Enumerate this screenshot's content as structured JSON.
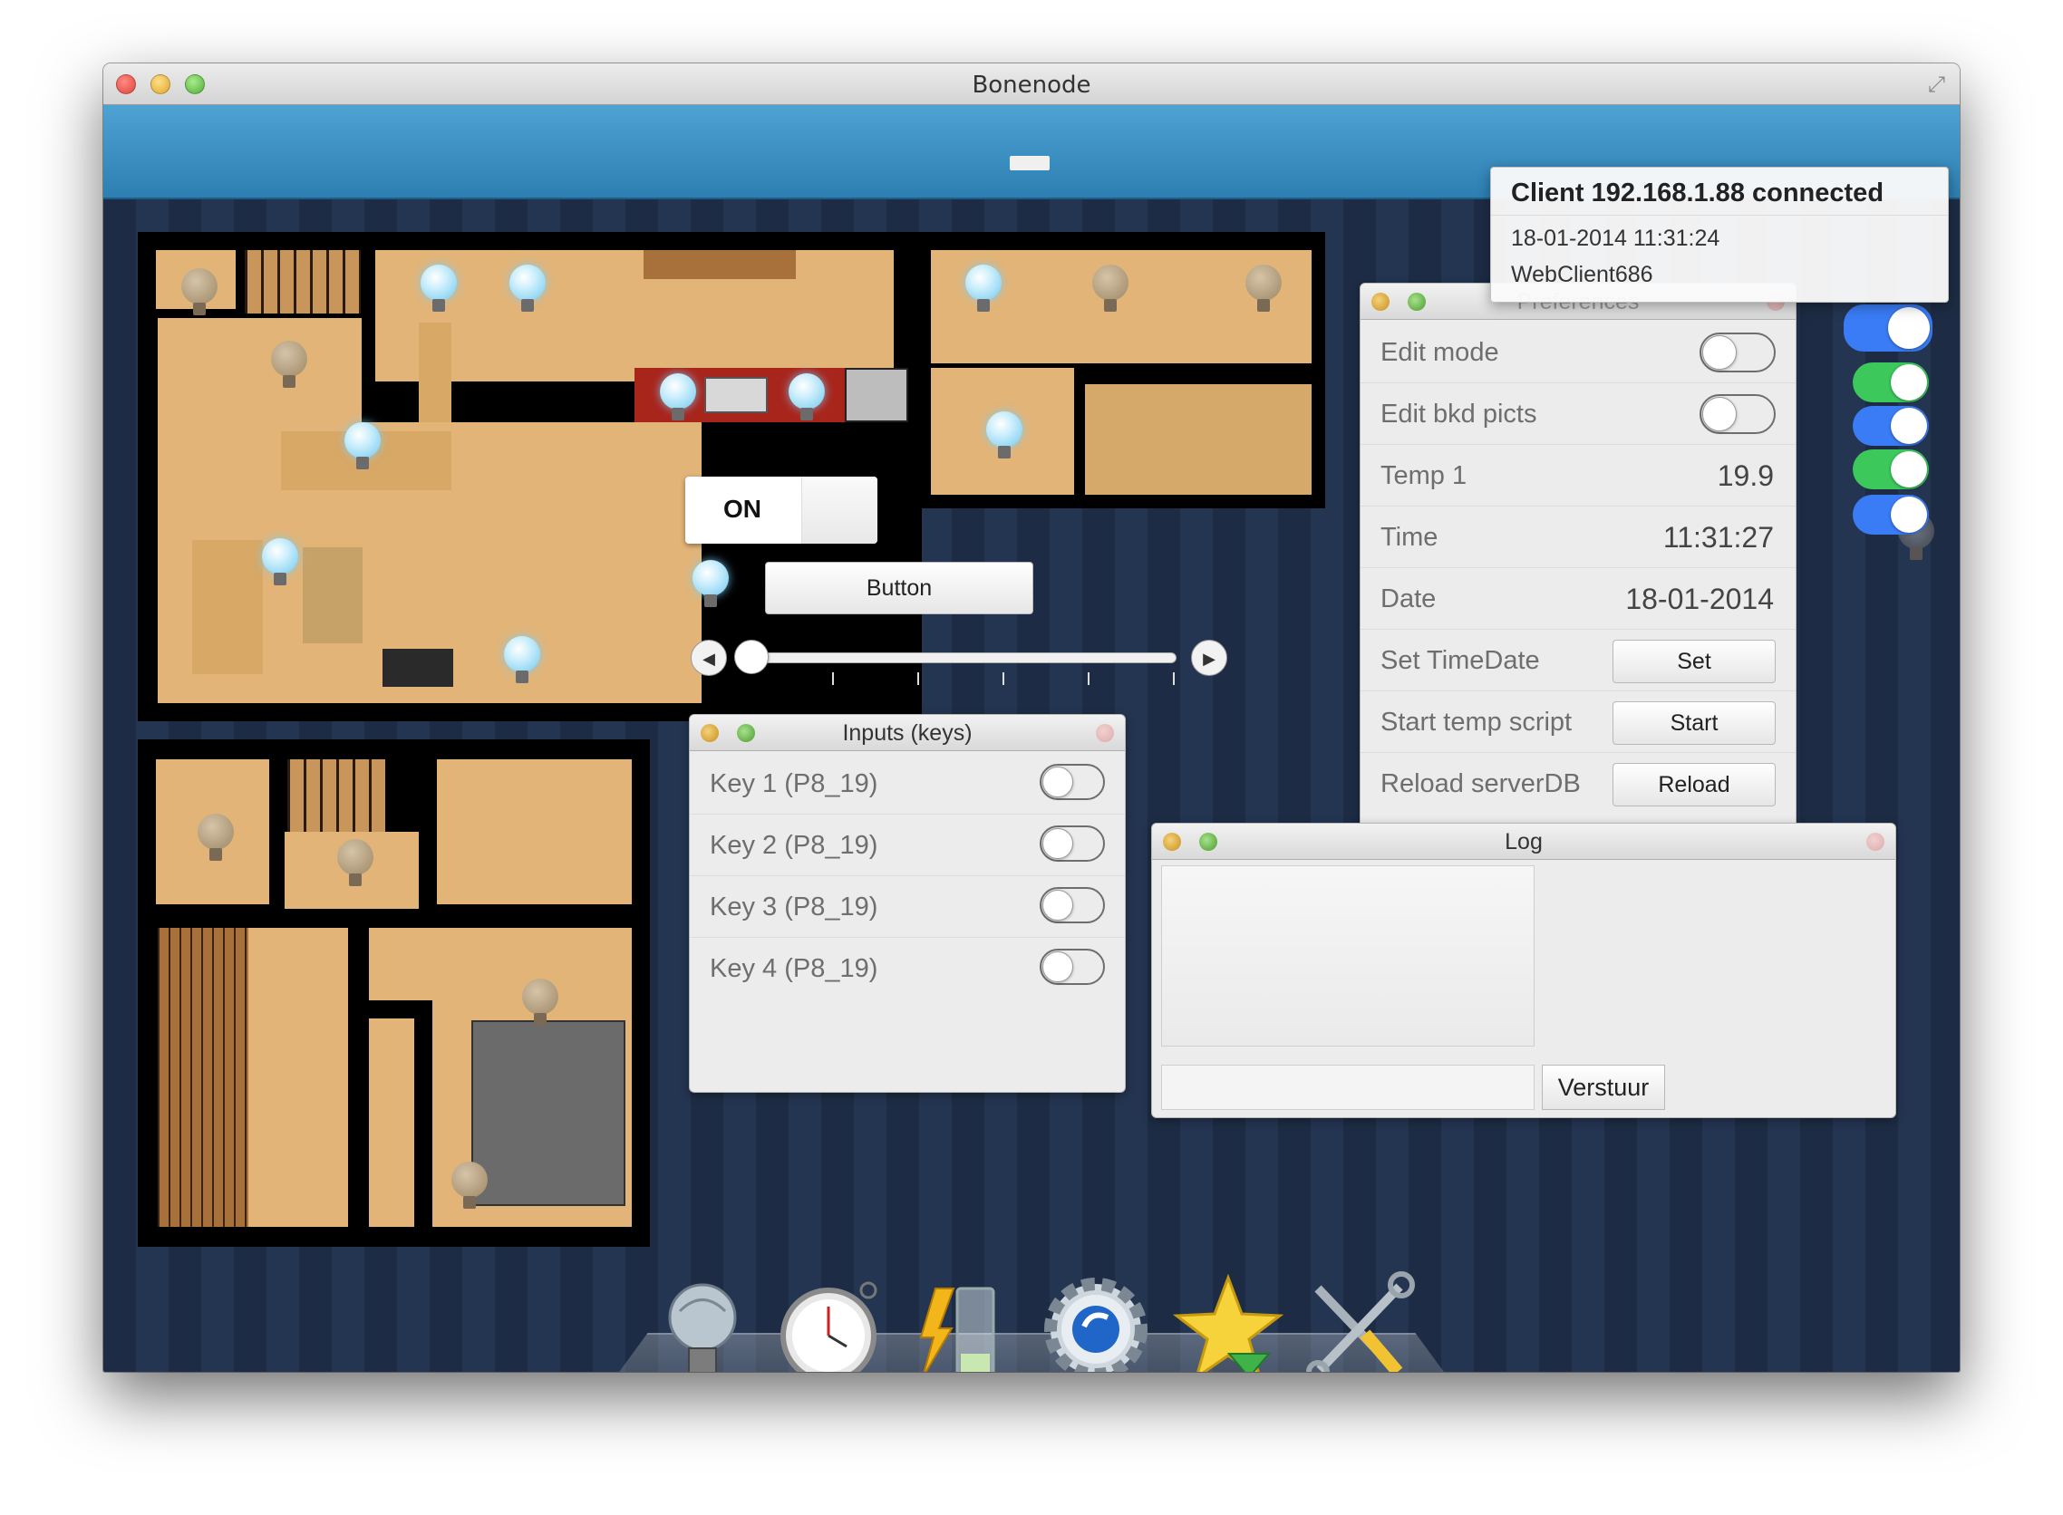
{
  "window": {
    "title": "Bonenode"
  },
  "notification": {
    "title": "Client 192.168.1.88 connected",
    "datetime": "18-01-2014 11:31:24",
    "client": "WebClient686"
  },
  "preferences": {
    "title": "Preferences",
    "rows": [
      {
        "label": "Edit mode",
        "type": "switch",
        "value": "off"
      },
      {
        "label": "Edit bkd picts",
        "type": "switch",
        "value": "off"
      },
      {
        "label": "Temp 1",
        "type": "value",
        "value": "19.9"
      },
      {
        "label": "Time",
        "type": "value",
        "value": "11:31:27"
      },
      {
        "label": "Date",
        "type": "value",
        "value": "18-01-2014"
      },
      {
        "label": "Set TimeDate",
        "type": "button",
        "value": "Set"
      },
      {
        "label": "Start temp script",
        "type": "button",
        "value": "Start"
      },
      {
        "label": "Reload serverDB",
        "type": "button",
        "value": "Reload"
      }
    ]
  },
  "inputs": {
    "title": "Inputs (keys)",
    "keys": [
      {
        "label": "Key 1 (P8_19)",
        "value": "off"
      },
      {
        "label": "Key 2 (P8_19)",
        "value": "off"
      },
      {
        "label": "Key 3 (P8_19)",
        "value": "off"
      },
      {
        "label": "Key 4 (P8_19)",
        "value": "off"
      }
    ]
  },
  "log": {
    "title": "Log",
    "input_value": "",
    "send_label": "Verstuur"
  },
  "controls": {
    "on_label": "ON",
    "button_label": "Button",
    "slider_value": 0
  },
  "side_toggles": [
    {
      "color": "#3a7cf5",
      "state": "on"
    },
    {
      "color": "#3cc85a",
      "state": "on"
    },
    {
      "color": "#3a7cf5",
      "state": "on"
    },
    {
      "color": "#3cc85a",
      "state": "on"
    },
    {
      "color": "#3a7cf5",
      "state": "on"
    }
  ],
  "dock": {
    "items": [
      "lightbulb-icon",
      "stopwatch-icon",
      "battery-power-icon",
      "gear-icon",
      "star-download-icon",
      "tools-icon"
    ]
  }
}
